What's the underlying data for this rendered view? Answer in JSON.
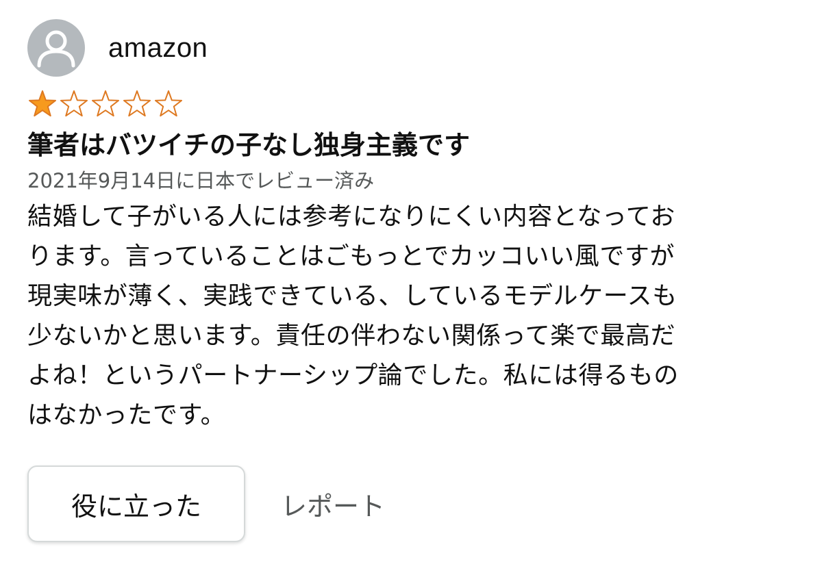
{
  "reviewer": {
    "name": "amazon",
    "avatar_icon": "user-silhouette-icon"
  },
  "rating": {
    "value": 1,
    "max": 5,
    "filled_color": "#f79a1e",
    "empty_color": "#de7921"
  },
  "review": {
    "title": "筆者はバツイチの子なし独身主義です",
    "date_line": "2021年9月14日に日本でレビュー済み",
    "body_lines": [
      "結婚して子がいる人には参考になりにくい内容となってお",
      "ります。言っていることはごもっとでカッコいい風ですが",
      "現実味が薄く、実践できている、しているモデルケースも",
      "少ないかと思います。責任の伴わない関係って楽で最高だ",
      "よね！というパートナーシップ論でした。私には得るもの",
      "はなかったです。"
    ]
  },
  "actions": {
    "helpful_label": "役に立った",
    "report_label": "レポート"
  }
}
